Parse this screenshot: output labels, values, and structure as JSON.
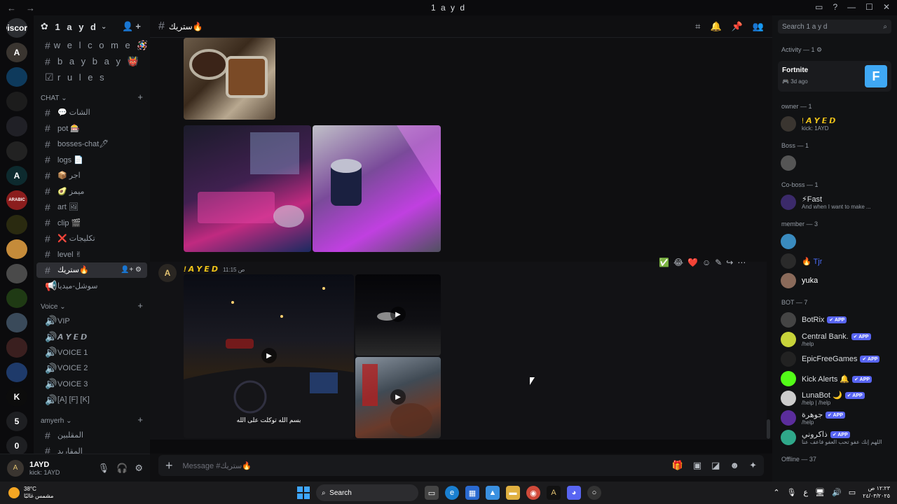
{
  "titlebar": {
    "title": "1 a y d",
    "back": "←",
    "forward": "→"
  },
  "servers": [
    {
      "label": "Discord",
      "color": "#2b2d31"
    },
    {
      "label": "A",
      "color": "#3a3530"
    },
    {
      "label": "",
      "color": "#0e3a5c"
    },
    {
      "label": "",
      "color": "#1c1c1c"
    },
    {
      "label": "",
      "color": "#202026"
    },
    {
      "label": "",
      "color": "#222"
    },
    {
      "label": "A",
      "color": "#0d2a2e"
    },
    {
      "label": "ARABIC",
      "color": "#8b1d1d"
    },
    {
      "label": "",
      "color": "#2a2a10"
    },
    {
      "label": "",
      "color": "#c58b3a"
    },
    {
      "label": "",
      "color": "#4a4a4a"
    },
    {
      "label": "",
      "color": "#1f3a14"
    },
    {
      "label": "",
      "color": "#3a4a5a"
    },
    {
      "label": "",
      "color": "#3a1f1f"
    },
    {
      "label": "",
      "color": "#1e3a6a"
    },
    {
      "label": "K",
      "color": "#0c0c0c"
    },
    {
      "label": "5",
      "color": "#1e1f22"
    },
    {
      "label": "0",
      "color": "#1e1f22"
    },
    {
      "label": "+",
      "color": "#1e1f22"
    }
  ],
  "server": {
    "name": "1 a y d"
  },
  "channels_top": [
    {
      "name": "w e l c o m e 🪅",
      "icon": "#"
    },
    {
      "name": "b a y b a y 👹",
      "icon": "#"
    },
    {
      "name": "r u l e s",
      "icon": "☑"
    }
  ],
  "cat_chat": "CHAT",
  "channels_chat": [
    {
      "name": "💬 الشات",
      "icon": "#"
    },
    {
      "name": "pot 🎰",
      "icon": "#"
    },
    {
      "name": "bosses-chat🖊",
      "icon": "#"
    },
    {
      "name": "logs 📄",
      "icon": "#"
    },
    {
      "name": "📦 اجر",
      "icon": "#"
    },
    {
      "name": "🥑 ميمز",
      "icon": "#"
    },
    {
      "name": "art 🖼",
      "icon": "#"
    },
    {
      "name": "clip 🎬",
      "icon": "#"
    },
    {
      "name": "❌ تكليجات",
      "icon": "#"
    },
    {
      "name": "level ✌",
      "icon": "#"
    },
    {
      "name": "ستريك🔥",
      "icon": "#",
      "selected": true
    },
    {
      "name": "سوشل-ميديا",
      "icon": "📢"
    }
  ],
  "cat_voice": "Voice",
  "channels_voice": [
    {
      "name": "VIP",
      "icon": "🔊"
    },
    {
      "name": "𝘼 𝙔 𝙀 𝘿",
      "icon": "🔊"
    },
    {
      "name": "VOICE 1",
      "icon": "🔊"
    },
    {
      "name": "VOICE 2",
      "icon": "🔊"
    },
    {
      "name": "VOICE 3",
      "icon": "🔊"
    },
    {
      "name": "[A] [F] [K]",
      "icon": "🔊"
    }
  ],
  "cat_amyerh": "amyerh",
  "channels_amyerh": [
    {
      "name": "المقلبين",
      "icon": "#"
    },
    {
      "name": "المقاريد",
      "icon": "#"
    }
  ],
  "user": {
    "name": "1AYD",
    "status": "kick: 1AYD"
  },
  "chat": {
    "channel": "ستريك🔥",
    "message_author": "! 𝘼 𝙔 𝙀 𝘿",
    "message_time": "11:15 ص",
    "video_caption": "بسم الله توكلت على الله",
    "placeholder": "Message #ستريك🔥",
    "reactions": [
      "✅",
      "😂",
      "❤️"
    ]
  },
  "members": {
    "search_placeholder": "Search 1 a y d",
    "activity_header": "Activity — 1",
    "activity": {
      "game": "Fortnite",
      "ago": "3d ago",
      "tile": "F"
    },
    "groups": [
      {
        "title": "owner — 1",
        "items": [
          {
            "name": "! 𝘼 𝙔 𝙀 𝘿",
            "sub": "kick: 1AYD",
            "color": "#f0c419",
            "av": "#3a3530"
          }
        ]
      },
      {
        "title": "Boss — 1",
        "items": [
          {
            "name": "",
            "sub": "",
            "color": "#dbdee1",
            "av": "#555"
          }
        ]
      },
      {
        "title": "Co-boss — 1",
        "items": [
          {
            "name": "⚡Fast",
            "sub": "And when I want to make ...",
            "color": "#dbdee1",
            "av": "#3b2a6a"
          }
        ]
      },
      {
        "title": "member — 3",
        "items": [
          {
            "name": "",
            "sub": "",
            "color": "#b02b2b",
            "av": "#3a8bbf"
          },
          {
            "name": "🔥 Tjr",
            "sub": "",
            "color": "#4a6cf7",
            "av": "#2a2a2a"
          },
          {
            "name": "yuka",
            "sub": "",
            "color": "#fff",
            "av": "#8a6a5a"
          }
        ]
      },
      {
        "title": "BOT — 7",
        "items": [
          {
            "name": "BotRix",
            "sub": "",
            "app": "✔ APP",
            "color": "#dbdee1",
            "av": "#444"
          },
          {
            "name": "Central Bank.",
            "sub": "/help",
            "app": "✔ APP",
            "color": "#dbdee1",
            "av": "#c7d33a"
          },
          {
            "name": "EpicFreeGames",
            "sub": "",
            "app": "✔ APP",
            "color": "#dbdee1",
            "av": "#222"
          },
          {
            "name": "Kick Alerts 🔔",
            "sub": "",
            "app": "✔ APP",
            "color": "#dbdee1",
            "av": "#53fc18"
          },
          {
            "name": "LunaBot 🌙",
            "sub": "/help | /help",
            "app": "✔ APP",
            "color": "#dbdee1",
            "av": "#ccc"
          },
          {
            "name": "جوهرة",
            "sub": "/help",
            "app": "✔ APP",
            "color": "#dbdee1",
            "av": "#5b2d9c"
          },
          {
            "name": "ذاكروني",
            "sub": "اللهم إنك عفو تحب العفو فاعف عنا",
            "app": "✔ APP",
            "color": "#dbdee1",
            "av": "#2fa88a"
          }
        ]
      }
    ],
    "offline": "Offline — 37"
  },
  "taskbar": {
    "temp": "38°C",
    "weather": "مشمس غالبًا",
    "search": "Search",
    "lang": "ع",
    "time": "١٢:٢٣ ص",
    "date": "٢٤/٠٣/٢٠٢٥"
  }
}
